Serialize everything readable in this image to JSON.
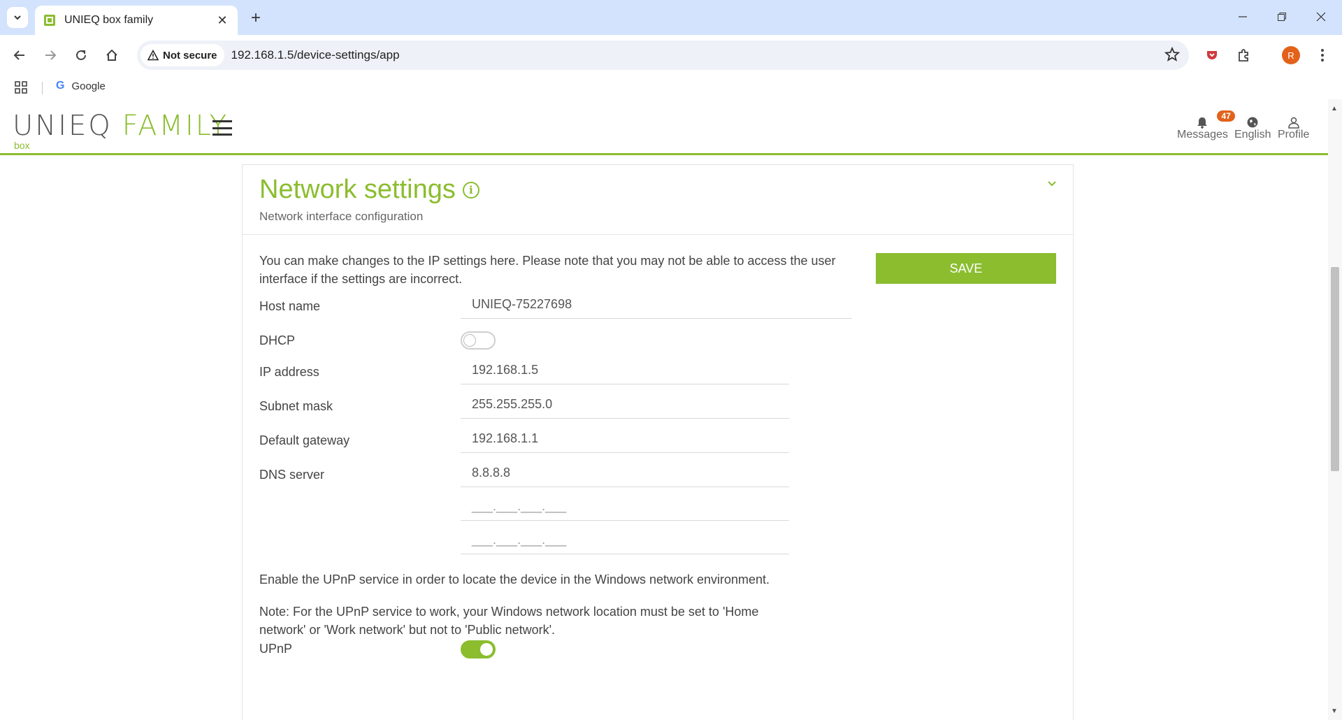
{
  "browser": {
    "tab_title": "UNIEQ box family",
    "url": "192.168.1.5/device-settings/app",
    "security_label": "Not secure",
    "profile_initial": "R",
    "bookmark_google": "Google"
  },
  "header": {
    "logo_unieq": "UNIEQ",
    "logo_family": "FAMILY",
    "logo_box": "box",
    "messages_label": "Messages",
    "messages_count": "47",
    "language_label": "English",
    "profile_label": "Profile"
  },
  "card": {
    "title": "Network settings",
    "subtitle": "Network interface configuration",
    "intro": "You can make changes to the IP settings here. Please note that you may not be able to access the user interface if the settings are incorrect.",
    "save_label": "SAVE",
    "fields": {
      "host_name_label": "Host name",
      "host_name_value": "UNIEQ-75227698",
      "dhcp_label": "DHCP",
      "dhcp_on": false,
      "ip_label": "IP address",
      "ip_value": "192.168.1.5",
      "subnet_label": "Subnet mask",
      "subnet_value": "255.255.255.0",
      "gateway_label": "Default gateway",
      "gateway_value": "192.168.1.1",
      "dns_label": "DNS server",
      "dns_value": "8.8.8.8",
      "dns2_placeholder": "___.___.___.___",
      "dns3_placeholder": "___.___.___.___"
    },
    "upnp_text": "Enable the UPnP service in order to locate the device in the Windows network environment.",
    "upnp_note": "Note: For the UPnP service to work, your Windows network location must be set to 'Home network' or 'Work network' but not to 'Public network'.",
    "upnp_label": "UPnP",
    "upnp_on": true
  },
  "colors": {
    "accent": "#8bbd2f",
    "badge": "#e2621b"
  }
}
